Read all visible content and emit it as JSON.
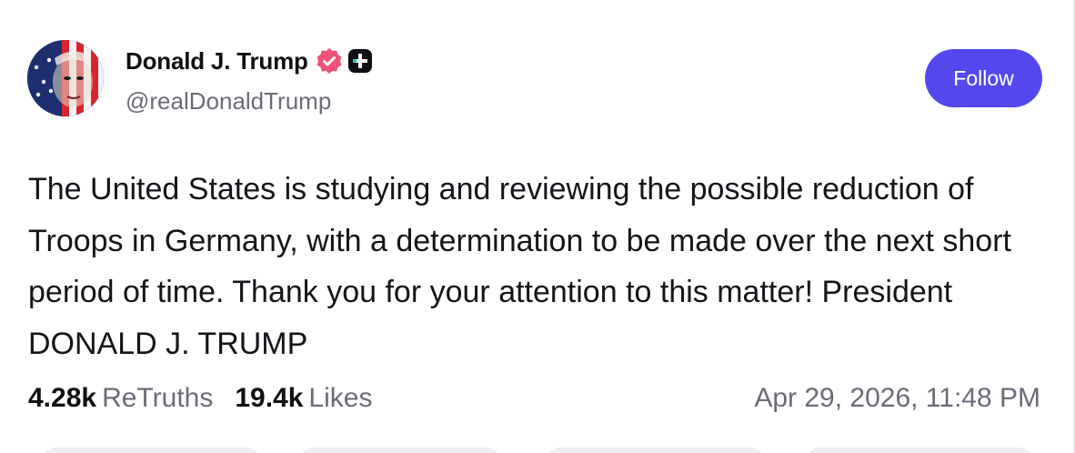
{
  "author": {
    "display_name": "Donald J. Trump",
    "handle": "@realDonaldTrump",
    "verified_icon": "verified-badge-icon",
    "verified_color": "#f0507a",
    "plus_icon": "plus-badge-icon"
  },
  "follow_button": {
    "label": "Follow",
    "color": "#5448ee"
  },
  "post": {
    "text": "The United States is studying and reviewing the possible reduction of Troops in Germany, with a determination to be made over the next short period of time. Thank you for your attention to this matter! President DONALD J. TRUMP"
  },
  "stats": {
    "retruths_count": "4.28k",
    "retruths_label": "ReTruths",
    "likes_count": "19.4k",
    "likes_label": "Likes"
  },
  "timestamp": "Apr 29, 2026, 11:48 PM"
}
